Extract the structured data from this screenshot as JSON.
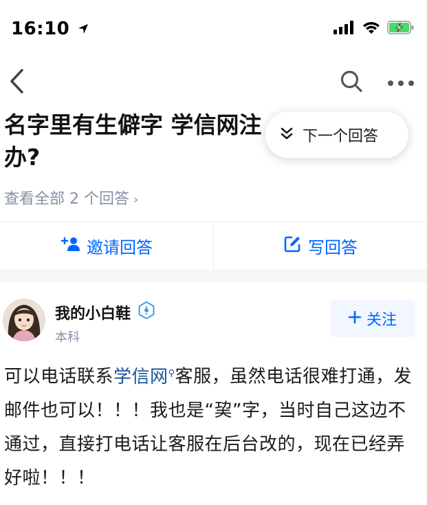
{
  "status_bar": {
    "time": "16:10",
    "icons": [
      "location-arrow-icon",
      "signal-icon",
      "wifi-icon",
      "battery-charging-icon"
    ]
  },
  "nav": {
    "icons": [
      "back-arrow-icon",
      "search-icon",
      "more-icon"
    ]
  },
  "question": {
    "title": "名字里有生僻字 学信网注",
    "title_line2": "办?",
    "all_answers_link": "查看全部 2 个回答",
    "next_answer_label": "下一个回答"
  },
  "actions": {
    "invite_label": "邀请回答",
    "write_label": "写回答"
  },
  "author": {
    "name": "我的小白鞋",
    "tag": "本科",
    "follow_label": "关注"
  },
  "answer": {
    "text_before_link": "可以电话联系",
    "link_text": "学信网",
    "text_after_link": "客服，虽然电话很难打通，发邮件也可以！！！我也是“巭”字，当时自己这边不通过，直接打电话让客服在后台改的，现在已经弄好啦！！！"
  },
  "colors": {
    "accent": "#0066ff",
    "link": "#175199",
    "muted": "#8590a6",
    "battery": "#4cd964"
  }
}
